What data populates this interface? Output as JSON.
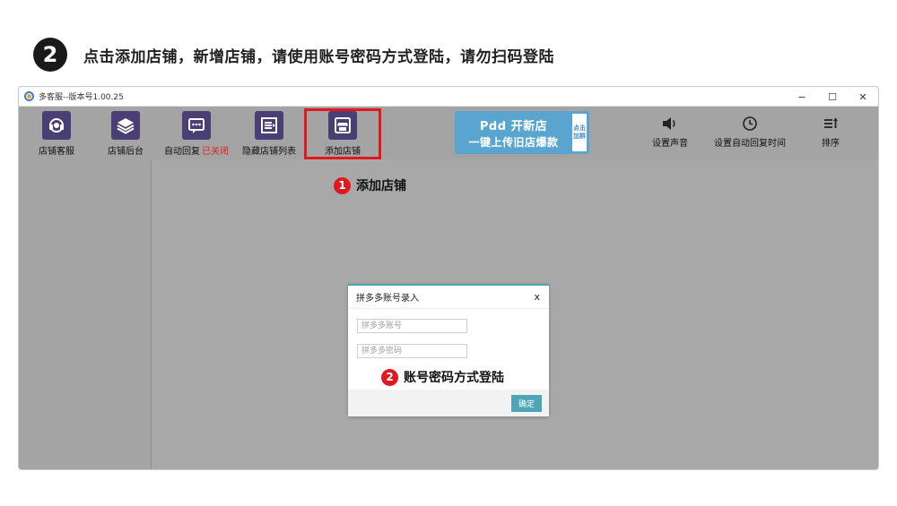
{
  "step": {
    "number": "2",
    "instruction": "点击添加店铺，新增店铺，请使用账号密码方式登陆，请勿扫码登陆"
  },
  "window": {
    "title": "多客服--版本号1.00.25",
    "controls": {
      "minimize": "−",
      "maximize": "☐",
      "close": "✕"
    }
  },
  "toolbar": {
    "items": [
      {
        "label": "店铺客服",
        "icon": "headset-icon"
      },
      {
        "label": "店铺后台",
        "icon": "layers-icon"
      },
      {
        "label": "自动回复",
        "status": "已关闭",
        "icon": "chat-bubble-icon"
      },
      {
        "label": "隐藏店铺列表",
        "icon": "list-collapse-icon"
      },
      {
        "label": "添加店铺",
        "icon": "store-icon"
      }
    ],
    "right_items": [
      {
        "label": "设置声音",
        "icon": "speaker-icon"
      },
      {
        "label": "设置自动回复时间",
        "icon": "clock-icon"
      },
      {
        "label": "排序",
        "icon": "sort-icon"
      }
    ],
    "banner": {
      "line1": "Pdd 开新店",
      "line2": "一键上传旧店爆款",
      "side": "点击加群"
    }
  },
  "callouts": [
    {
      "number": "1",
      "text": "添加店铺"
    },
    {
      "number": "2",
      "text": "账号密码方式登陆"
    }
  ],
  "dialog": {
    "title": "拼多多账号录入",
    "close": "x",
    "username_placeholder": "拼多多账号",
    "password_placeholder": "拼多多密码",
    "confirm": "确定"
  },
  "colors": {
    "toolbar_icon_bg": "#4a3f74",
    "highlight": "#e0191e",
    "accent": "#4fa5b5",
    "banner": "#5aa5cf"
  }
}
